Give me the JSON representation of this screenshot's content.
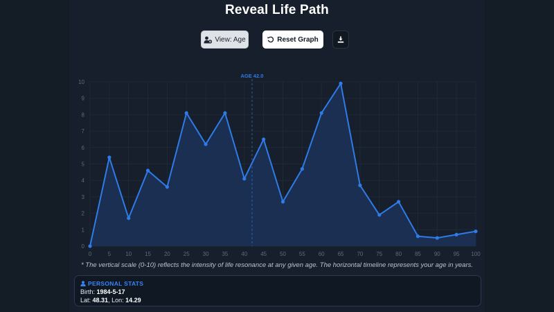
{
  "page": {
    "title": "Reveal Life Path",
    "view_button": "View: Age",
    "reset_button": "Reset Graph",
    "download_icon": "download-icon",
    "user_icon": "user-gear-icon",
    "reset_icon": "rotate-left-icon"
  },
  "chart_data": {
    "type": "area",
    "title": "",
    "xlabel": "",
    "ylabel": "",
    "x": [
      0,
      5,
      10,
      15,
      20,
      25,
      30,
      35,
      40,
      45,
      50,
      55,
      60,
      65,
      70,
      75,
      80,
      85,
      90,
      95,
      100
    ],
    "values": [
      0,
      5.4,
      1.7,
      4.6,
      3.6,
      8.1,
      6.2,
      8.1,
      4.1,
      6.5,
      2.7,
      4.7,
      8.1,
      9.9,
      3.7,
      1.9,
      2.7,
      0.6,
      0.5,
      0.7,
      0.9
    ],
    "xlim": [
      0,
      100
    ],
    "ylim": [
      0,
      10
    ],
    "x_ticks": [
      0,
      5,
      10,
      15,
      20,
      25,
      30,
      35,
      40,
      45,
      50,
      55,
      60,
      65,
      70,
      75,
      80,
      85,
      90,
      95,
      100
    ],
    "y_ticks": [
      0,
      1,
      2,
      3,
      4,
      5,
      6,
      7,
      8,
      9,
      10
    ],
    "grid": true,
    "marker_x": 42.0,
    "marker_label": "AGE 42.0",
    "colors": {
      "line": "#2f7be8",
      "fill": "#1b3358",
      "marker": "#2f7be8",
      "grid": "#1f2a37",
      "tick": "#5f6b7a"
    }
  },
  "footnote": "* The vertical scale (0-10) reflects the intensity of life resonance at any given age. The horizontal timeline represents your age in years.",
  "stats": {
    "header": "PERSONAL STATS",
    "header_icon": "user-icon",
    "birth_label": "Birth:",
    "birth_value": "1984-5-17",
    "lat_label": "Lat:",
    "lat_value": "48.31",
    "lon_label": "Lon:",
    "lon_value": "14.29"
  }
}
